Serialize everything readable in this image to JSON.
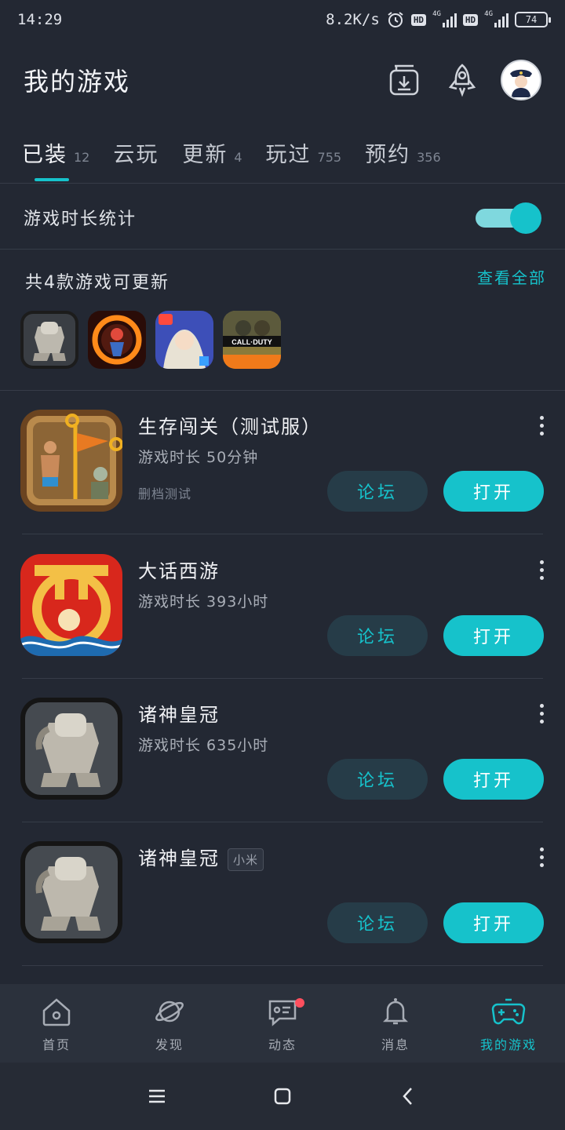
{
  "status_bar": {
    "time": "14:29",
    "network_speed": "8.2K/s",
    "hd1": "HD",
    "net1": "4G",
    "hd2": "HD",
    "net2": "4G",
    "battery": "74"
  },
  "header": {
    "title": "我的游戏",
    "icons": [
      "download-manager-icon",
      "rocket-icon",
      "avatar"
    ]
  },
  "tabs": [
    {
      "label": "已装",
      "count": "12",
      "active": true
    },
    {
      "label": "云玩",
      "count": ""
    },
    {
      "label": "更新",
      "count": "4"
    },
    {
      "label": "玩过",
      "count": "755"
    },
    {
      "label": "预约",
      "count": "356"
    }
  ],
  "playtime_toggle": {
    "label": "游戏时长统计",
    "on": true
  },
  "updates": {
    "title": "共4款游戏可更新",
    "view_all": "查看全部",
    "icons": [
      "armor-game-icon",
      "fire-ring-game-icon",
      "anime-girl-game-icon",
      "call-of-duty-game-icon"
    ],
    "cod_text": "CALL·DUTY"
  },
  "games": [
    {
      "name": "生存闯关（测试服）",
      "tag": "",
      "playtime": "游戏时长 50分钟",
      "note": "删档测试",
      "forum": "论坛",
      "open": "打开"
    },
    {
      "name": "大话西游",
      "tag": "",
      "playtime": "游戏时长 393小时",
      "note": "",
      "forum": "论坛",
      "open": "打开"
    },
    {
      "name": "诸神皇冠",
      "tag": "",
      "playtime": "游戏时长 635小时",
      "note": "",
      "forum": "论坛",
      "open": "打开"
    },
    {
      "name": "诸神皇冠",
      "tag": "小米",
      "playtime": "",
      "note": "",
      "forum": "论坛",
      "open": "打开"
    }
  ],
  "bottom_nav": [
    {
      "label": "首页",
      "icon": "home-icon"
    },
    {
      "label": "发现",
      "icon": "planet-icon"
    },
    {
      "label": "动态",
      "icon": "message-icon",
      "badge": true
    },
    {
      "label": "消息",
      "icon": "bell-icon"
    },
    {
      "label": "我的游戏",
      "icon": "gamepad-icon",
      "active": true
    }
  ],
  "colors": {
    "background": "#232833",
    "accent": "#16c2cb",
    "forum_button": "#263c48",
    "nav_background": "#2b313c",
    "badge": "#ff4f5e"
  }
}
